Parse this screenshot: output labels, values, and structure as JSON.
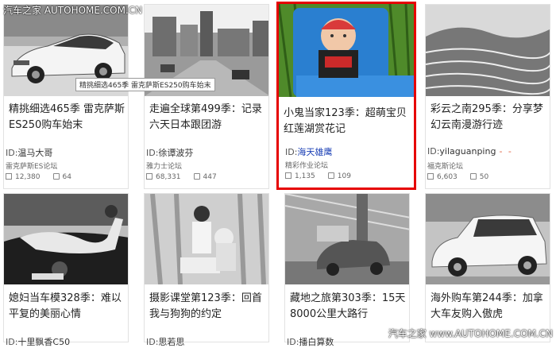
{
  "watermarks": {
    "top_left": "汽车之家 AUTOHOME.COM.CN",
    "bottom_right": "汽车之家 www.AUTOHOME.COM.CN"
  },
  "tooltip": "精挑细选465季 雷克萨斯ES250购车始末",
  "cards": [
    {
      "title": "精挑细选465季 雷克萨斯ES250购车始末",
      "id_prefix": "ID:",
      "author": "温马大哥",
      "forum": "雷克萨斯ES论坛",
      "views": "12,380",
      "comments": "64"
    },
    {
      "title": "走遍全球第499季：记录六天日本跟团游",
      "id_prefix": "ID:",
      "author": "徐谭波芬",
      "forum": "雅力士论坛",
      "views": "68,331",
      "comments": "447"
    },
    {
      "title": "小鬼当家123季：超萌宝贝红莲湖赏花记",
      "id_prefix": "ID:",
      "author": "海天雄鹰",
      "forum": "精彩作业论坛",
      "views": "1,135",
      "comments": "109"
    },
    {
      "title": "彩云之南295季：分享梦幻云南漫游行迹",
      "id_prefix": "ID:",
      "author": "yilaguanping",
      "author_suffix": "- -",
      "forum": "福克斯论坛",
      "views": "6,603",
      "comments": "50"
    },
    {
      "title": "媳妇当车模328季：难以平复的美丽心情",
      "id_prefix": "ID:",
      "author": "十里飘香C50"
    },
    {
      "title": "摄影课堂第123季：回首我与狗狗的约定",
      "id_prefix": "ID:",
      "author": "思若思"
    },
    {
      "title": "藏地之旅第303季：15天8000公里大路行",
      "id_prefix": "ID:",
      "author": "播白算数"
    },
    {
      "title": "海外购车第244季：加拿大车友购入傲虎"
    }
  ]
}
